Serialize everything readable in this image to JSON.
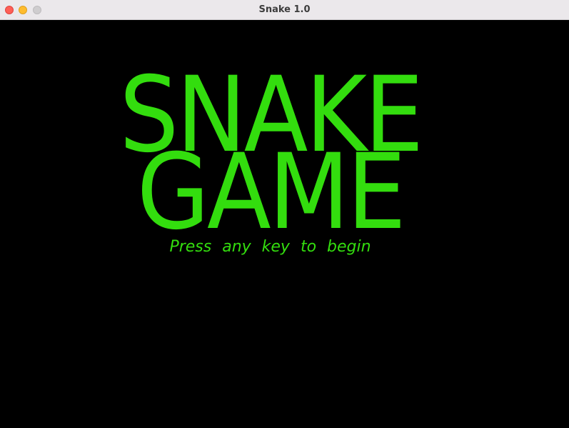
{
  "window": {
    "title": "Snake 1.0"
  },
  "game": {
    "title_line1": "SNAKE",
    "title_line2": "GAME",
    "prompt": "Press any key to begin"
  },
  "colors": {
    "text": "#33dd0e",
    "background": "#000000",
    "close": "#fe5f57",
    "minimize": "#febc2e",
    "maximize": "#cfcdcf"
  }
}
